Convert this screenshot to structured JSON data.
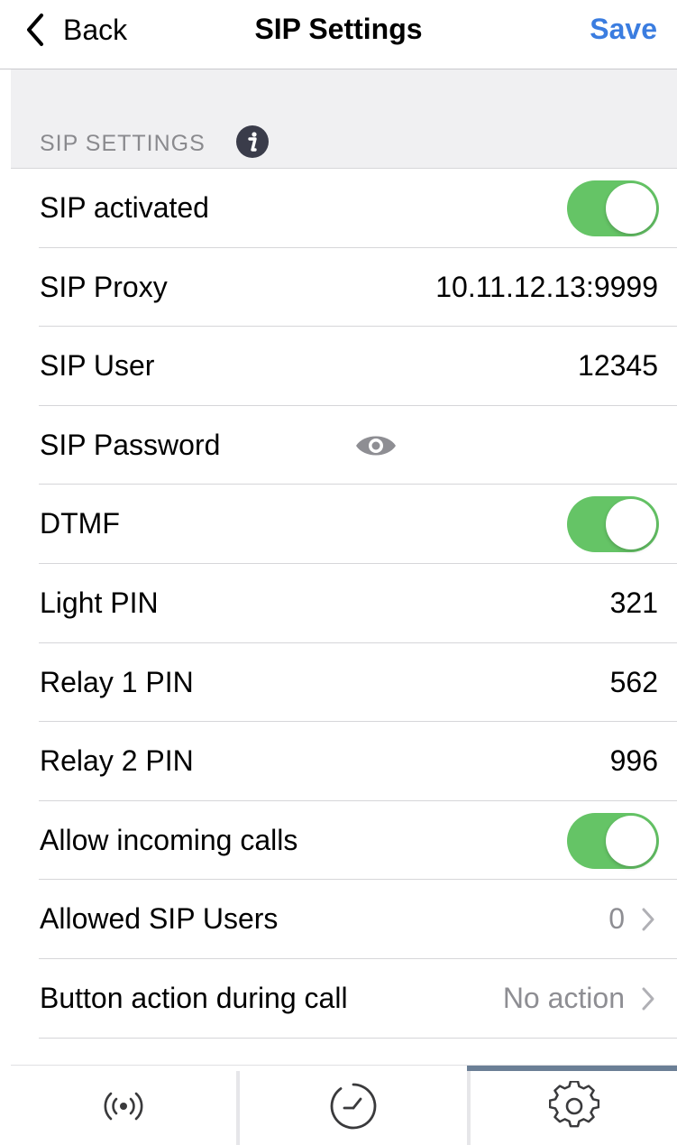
{
  "nav": {
    "back_label": "Back",
    "title": "SIP Settings",
    "save_label": "Save"
  },
  "section": {
    "title": "SIP SETTINGS",
    "info_icon": "info-icon"
  },
  "rows": [
    {
      "label": "SIP activated",
      "type": "toggle",
      "on": true
    },
    {
      "label": "SIP Proxy",
      "type": "value",
      "value": "10.11.12.13:9999"
    },
    {
      "label": "SIP User",
      "type": "value",
      "value": "12345"
    },
    {
      "label": "SIP Password",
      "type": "password",
      "icon": "eye-icon"
    },
    {
      "label": "DTMF",
      "type": "toggle",
      "on": true
    },
    {
      "label": "Light PIN",
      "type": "value",
      "value": "321"
    },
    {
      "label": "Relay 1 PIN",
      "type": "value",
      "value": "562"
    },
    {
      "label": "Relay 2 PIN",
      "type": "value",
      "value": "996"
    },
    {
      "label": "Allow incoming calls",
      "type": "toggle",
      "on": true
    },
    {
      "label": "Allowed SIP Users",
      "type": "disclosure",
      "value": "0"
    },
    {
      "label": "Button action during call",
      "type": "disclosure",
      "value": "No action"
    }
  ],
  "tabbar": {
    "tabs": [
      {
        "icon": "broadcast-icon",
        "active": false
      },
      {
        "icon": "clock-icon",
        "active": false
      },
      {
        "icon": "gear-icon",
        "active": true
      }
    ]
  },
  "colors": {
    "accent": "#3b7de0",
    "toggle_on": "#65c466",
    "section_bg": "#f0f0f2",
    "muted_text": "#8e8e93",
    "active_tab_indicator": "#6b7f96"
  }
}
